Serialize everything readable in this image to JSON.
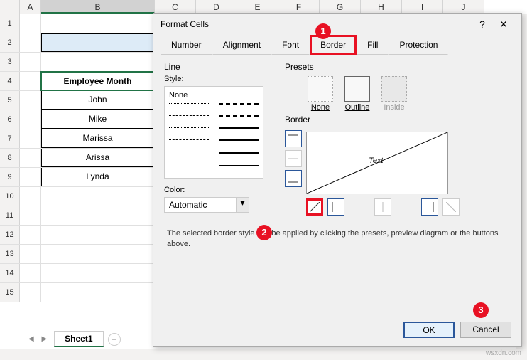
{
  "columns": [
    "A",
    "B",
    "C",
    "D",
    "E",
    "F",
    "G",
    "H",
    "I",
    "J"
  ],
  "rows": [
    "1",
    "2",
    "3",
    "4",
    "5",
    "6",
    "7",
    "8",
    "9",
    "10",
    "11",
    "12",
    "13",
    "14",
    "15"
  ],
  "table": {
    "header": "Employee Month",
    "data": [
      "John",
      "Mike",
      "Marissa",
      "Arissa",
      "Lynda"
    ]
  },
  "sheet_tab": "Sheet1",
  "dialog": {
    "title": "Format Cells",
    "help": "?",
    "close": "✕",
    "tabs": [
      "Number",
      "Alignment",
      "Font",
      "Border",
      "Fill",
      "Protection"
    ],
    "line_label": "Line",
    "style_label": "Style:",
    "style_none": "None",
    "color_label": "Color:",
    "color_value": "Automatic",
    "presets_label": "Presets",
    "preset_none": "None",
    "preset_outline": "Outline",
    "preset_inside": "Inside",
    "border_label": "Border",
    "preview_text": "Text",
    "help_text": "The selected border style can be applied by clicking the presets, preview diagram or the buttons above.",
    "ok": "OK",
    "cancel": "Cancel"
  },
  "callouts": {
    "c1": "1",
    "c2": "2",
    "c3": "3"
  },
  "watermark": "wsxdn.com"
}
